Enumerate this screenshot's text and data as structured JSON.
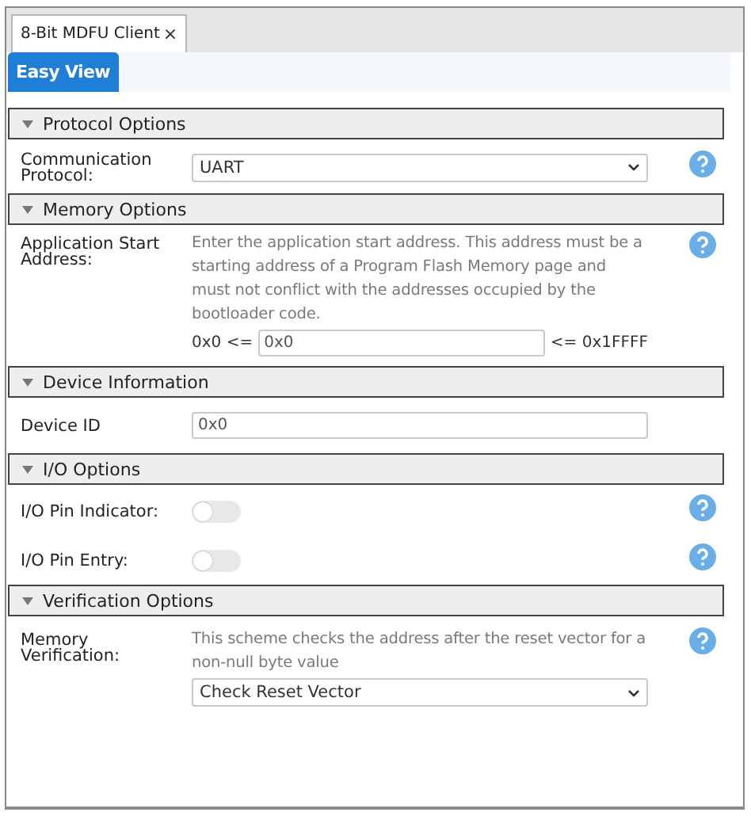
{
  "document_tab": {
    "title": "8-Bit MDFU Client",
    "close": "×"
  },
  "view_tabs": [
    {
      "label": "Easy View",
      "selected": true
    }
  ],
  "sections": [
    {
      "title": "Protocol Options",
      "expanded": true,
      "rows": [
        {
          "kind": "select",
          "label": "Communication Protocol:",
          "value": "UART",
          "help": true
        }
      ]
    },
    {
      "title": "Memory Options",
      "expanded": true,
      "rows": [
        {
          "kind": "range",
          "label": "Application Start Address:",
          "description": "Enter the application start address. This address must be a starting address of a Program Flash Memory page and must not conflict with the addresses occupied by the bootloader code.",
          "min_label": "0x0 <=",
          "value": "0x0",
          "max_label": "<= 0x1FFFF",
          "help": true
        }
      ]
    },
    {
      "title": "Device Information",
      "expanded": true,
      "rows": [
        {
          "kind": "text",
          "label": "Device ID",
          "value": "0x0",
          "help": false
        }
      ]
    },
    {
      "title": "I/O Options",
      "expanded": true,
      "rows": [
        {
          "kind": "switch",
          "label": "I/O Pin Indicator:",
          "on": false,
          "help": true
        },
        {
          "kind": "switch",
          "label": "I/O Pin Entry:",
          "on": false,
          "help": true
        }
      ]
    },
    {
      "title": "Verification Options",
      "expanded": true,
      "rows": [
        {
          "kind": "select",
          "label": "Memory Verification:",
          "description": "This scheme checks the address after the reset vector for a non-null byte value",
          "value": "Check Reset Vector",
          "help": true
        }
      ]
    }
  ]
}
